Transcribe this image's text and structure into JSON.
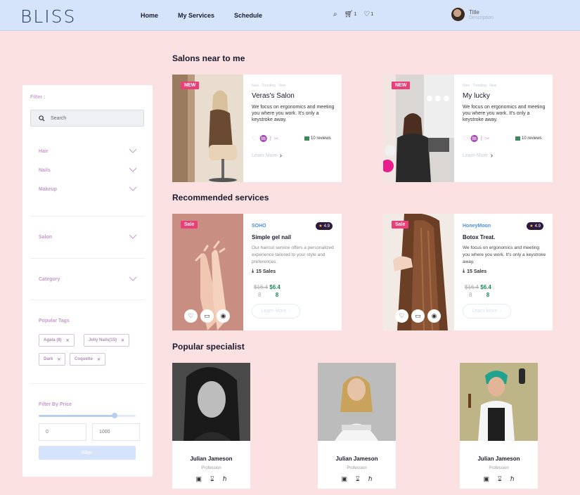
{
  "nav": {
    "logo": "BLISS",
    "links": [
      "Home",
      "My Services",
      "Schedule"
    ],
    "cart_count": "1",
    "fav_count": "1",
    "profile_title": "Title",
    "profile_desc": "Description"
  },
  "sidebar": {
    "filter_label": "Filter :",
    "search_placeholder": "Search",
    "accordions": [
      "Hair",
      "Nails",
      "Makeup",
      "Salon",
      "Category"
    ],
    "popular_tags_label": "Popular Tags",
    "tags": [
      "Agata (8)",
      "Jelly Nails(15)",
      "Dark",
      "Coquette"
    ],
    "filter_by_price_label": "Filter By Price",
    "price_min": "0",
    "price_max": "1000",
    "price_slider_fraction": 0.78,
    "filter_button": "Filter"
  },
  "sections": {
    "salons": "Salons near to me",
    "recommended": "Recommended services",
    "specialists": "Popular specialist"
  },
  "salons": [
    {
      "badge": "NEW",
      "crumb": "New · Trending · New",
      "name": "Veras's Salon",
      "desc": "We focus on ergonomics and meeting you where you work. It's only a keystroke away.",
      "reviews": "10 reviews",
      "learn": "Learn More"
    },
    {
      "badge": "NEW",
      "crumb": "New · Trending · New",
      "name": "My lucky",
      "desc": "We focus on ergonomics and meeting you where you work. It's only a keystroke away.",
      "reviews": "10 reviews",
      "learn": "Learn More"
    }
  ],
  "services": [
    {
      "badge": "Sale",
      "brand": "SOHO",
      "rating": "4.9",
      "name": "Simple gel nail",
      "desc": "Our haircut service offers a personalized experience tailored to your style and preferences.",
      "sales": "15 Sales",
      "old_price": "$16.4",
      "old_price_2": "8",
      "new_price": "$6.4",
      "new_price_2": "8",
      "learn": "Learn More"
    },
    {
      "badge": "Sale",
      "brand": "HoneyMoon",
      "rating": "4.9",
      "name": "Botox Treat.",
      "desc": "We focus on ergonomics and meeting you where you work. It's only a keystroke away.",
      "sales": "15 Sales",
      "old_price": "$16.4",
      "old_price_2": "8",
      "new_price": "$6.4",
      "new_price_2": "8",
      "learn": "Learn More"
    }
  ],
  "specialists": [
    {
      "name": "Julian Jameson",
      "profession": "Profession"
    },
    {
      "name": "Julian Jameson",
      "profession": "Profession"
    },
    {
      "name": "Julian Jameson",
      "profession": "Profession"
    }
  ],
  "colors": {
    "accent": "#ec3f7a",
    "nav_bg": "#d6e4fb",
    "page_bg": "#fbe1e1",
    "price_green": "#1a8a5a",
    "brand_blue": "#4a90d9"
  }
}
